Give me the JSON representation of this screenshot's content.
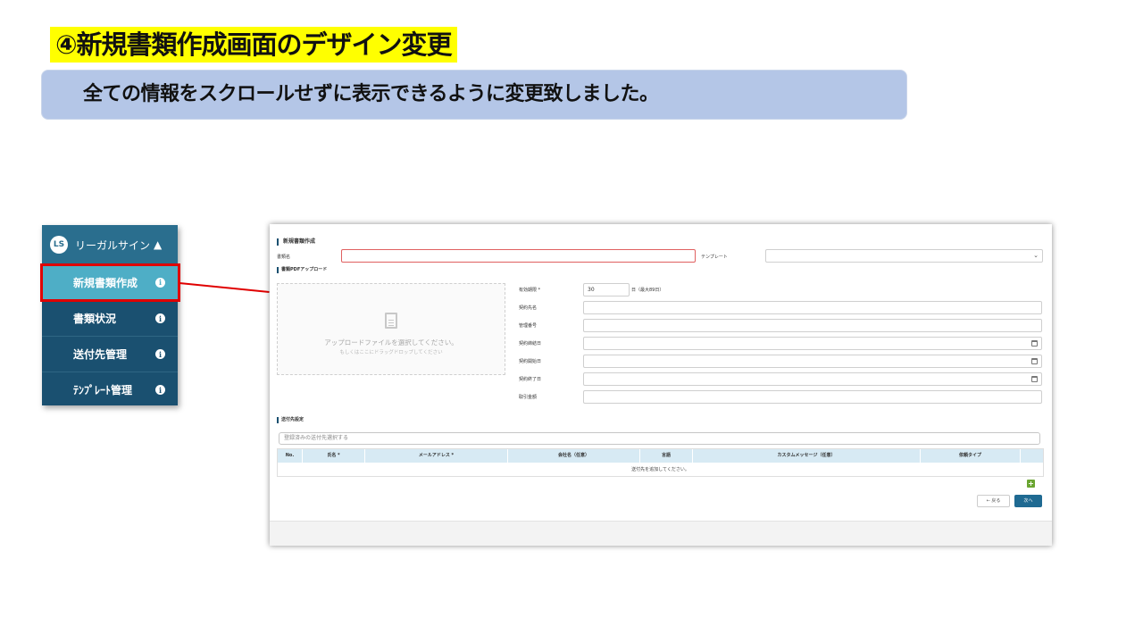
{
  "slide": {
    "title": "④新規書類作成画面のデザイン変更",
    "subtitle": "全ての情報をスクロールせずに表示できるように変更致しました。"
  },
  "sidebar": {
    "logo_text": "LS",
    "brand": "リーガルサイン",
    "items": [
      {
        "label": "新規書類作成",
        "active": true
      },
      {
        "label": "書類状況",
        "active": false
      },
      {
        "label": "送付先管理",
        "active": false
      },
      {
        "label": "ﾃﾝﾌﾟﾚｰﾄ管理",
        "active": false
      }
    ]
  },
  "form": {
    "page_title": "新規書類作成",
    "doc_name_label": "書類名",
    "doc_name_value": "",
    "template_label": "テンプレート",
    "template_value": "",
    "pdf_section": "書類PDFアップロード",
    "upload_main": "アップロードファイルを選択してください。",
    "upload_sub": "もしくはここにドラッグドロップしてください",
    "fields": {
      "validity_label": "有効期限 *",
      "validity_value": "30",
      "validity_unit": "日（最大89日）",
      "partner_label": "契約先名",
      "mgmt_label": "管理番号",
      "signed_label": "契約締結日",
      "start_label": "契約開始日",
      "end_label": "契約終了日",
      "amount_label": "取引金額"
    }
  },
  "recipients": {
    "section": "送付先設定",
    "search_placeholder": "登録済みの送付先選択する",
    "columns": [
      "No.",
      "氏名 *",
      "メールアドレス *",
      "会社名（任意）",
      "言語",
      "カスタムメッセージ（任意）",
      "依頼タイプ"
    ],
    "empty_text": "送付先を追加してください。"
  },
  "buttons": {
    "add": "+",
    "back": "← 戻る",
    "next": "次へ"
  },
  "colors": {
    "title_highlight": "#ffff00",
    "subtitle_box": "#b4c6e7",
    "sidebar_bg": "#1a5070",
    "sidebar_active": "#4eaec6",
    "callout_red": "#e00000",
    "primary_button": "#1f6a92"
  }
}
